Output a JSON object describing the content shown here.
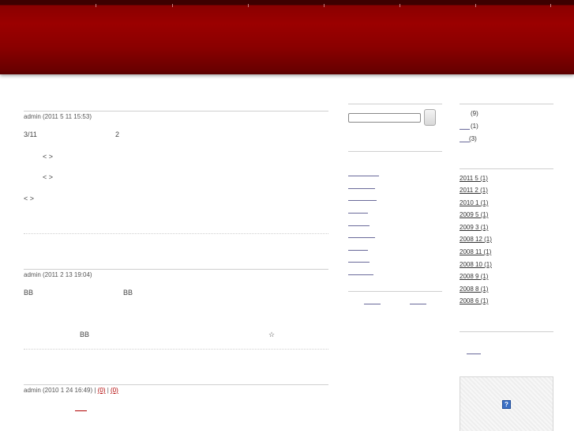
{
  "posts": [
    {
      "meta": "admin (2011 5 11  15:53)",
      "lines": [
        "3/11",
        "2",
        "<    >",
        "<    >",
        "<    >"
      ]
    },
    {
      "meta": "admin (2011 2 13  19:04)",
      "lines": [
        "BB",
        "BB",
        "BB",
        "☆"
      ]
    },
    {
      "meta_prefix": "admin (2010 1 24  16:49) | ",
      "comments": "(0)",
      "separator": " | ",
      "trackbacks": "(0)"
    }
  ],
  "sidebar_right": {
    "categories": [
      {
        "count": "(9)"
      },
      {
        "count": "(1)"
      },
      {
        "count": "(3)"
      }
    ],
    "archives": [
      "2011 5  (1)",
      "2011 2  (1)",
      "2010 1  (1)",
      "2009 5  (1)",
      "2009 3  (1)",
      "2008 12  (1)",
      "2008 11  (1)",
      "2008 10  (1)",
      "2008 9  (1)",
      "2008 8  (1)",
      "2008 6  (1)"
    ],
    "widget_icon": "?"
  },
  "colors": {
    "header": "#9b0000",
    "header_dark": "#3d0000",
    "link": "#b00000"
  }
}
